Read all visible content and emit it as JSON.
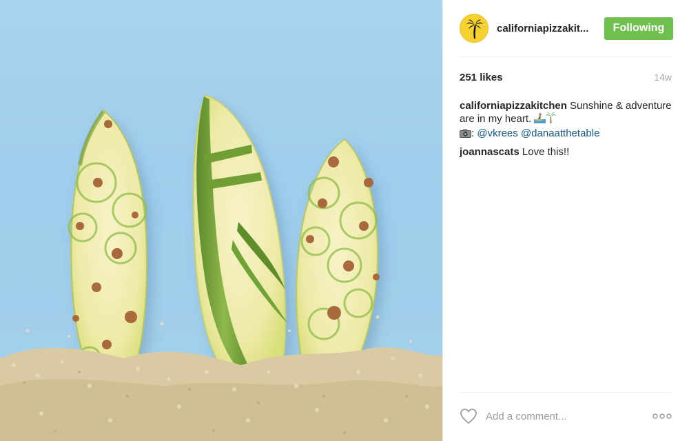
{
  "post": {
    "username": "californiapizzakit...",
    "follow_label": "Following",
    "likes": "251 likes",
    "timestamp": "14w"
  },
  "caption": {
    "author": "californiapizzakitchen",
    "text": "Sunshine & adventure are in my heart.",
    "credit_prefix": ":",
    "mention_1": "@vkrees",
    "mention_2": "@danaatthetable"
  },
  "comments": [
    {
      "author": "joannascats",
      "text": "Love this!!"
    }
  ],
  "footer": {
    "comment_placeholder": "Add a comment..."
  },
  "icons": {
    "avatar": "palm-tree-icon",
    "like": "heart-icon",
    "more": "more-options-icon",
    "caption_emoji_1": "surfer-icon",
    "caption_emoji_2": "palm-tree-icon",
    "camera": "camera-icon"
  },
  "colors": {
    "follow_button": "#70c050",
    "avatar_bg": "#f6d12f",
    "mention": "#125688",
    "photo_bg": "#a4d0ec"
  }
}
